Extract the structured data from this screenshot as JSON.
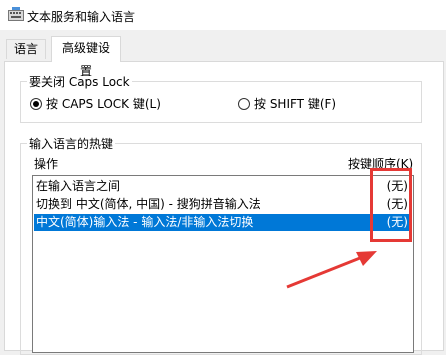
{
  "window": {
    "title": "文本服务和输入语言"
  },
  "tabs": [
    {
      "label": "语言栏",
      "active": false
    },
    {
      "label": "高级键设置",
      "active": true
    }
  ],
  "caps_lock_group": {
    "title": "要关闭 Caps Lock",
    "options": [
      {
        "label": "按 CAPS LOCK 键(L)",
        "selected": true
      },
      {
        "label": "按 SHIFT 键(F)",
        "selected": false
      }
    ]
  },
  "hotkeys_group": {
    "title": "输入语言的热键",
    "column_action": "操作",
    "column_key": "按键顺序(K)",
    "rows": [
      {
        "action": "在输入语言之间",
        "key": "(无)",
        "selected": false
      },
      {
        "action": "切换到 中文(简体, 中国) - 搜狗拼音输入法",
        "key": "(无)",
        "selected": false
      },
      {
        "action": "中文(简体)输入法 - 输入法/非输入法切换",
        "key": "(无)",
        "selected": true
      }
    ]
  },
  "colors": {
    "selection": "#0078d7",
    "annotation": "#e53935"
  }
}
